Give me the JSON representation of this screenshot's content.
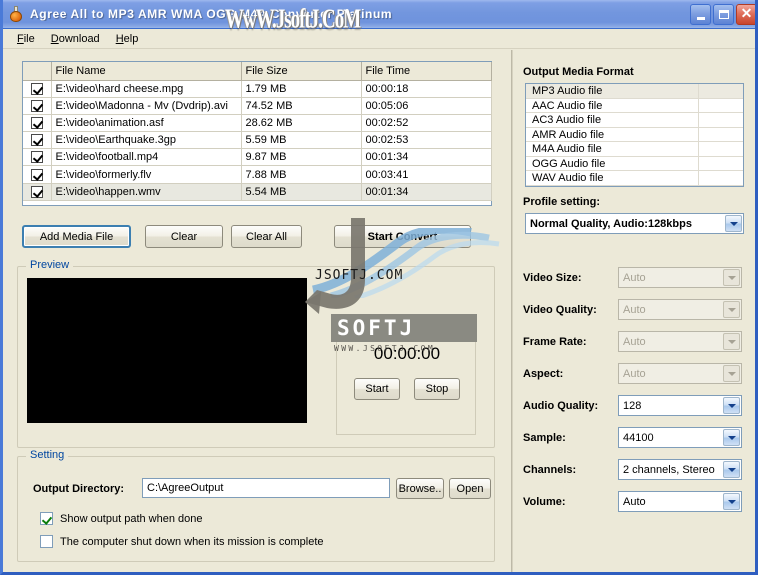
{
  "window": {
    "title": "Agree All to MP3 AMR WMA OGG M4A Converter Platinum",
    "icon": "flask-icon",
    "buttons": {
      "minimize": "minimize-icon",
      "maximize": "maximize-icon",
      "close": "close-icon"
    }
  },
  "menu": {
    "items": [
      {
        "label": "File",
        "accel": "F"
      },
      {
        "label": "Download",
        "accel": "D"
      },
      {
        "label": "Help",
        "accel": "H"
      }
    ]
  },
  "filelist": {
    "columns": [
      "",
      "File Name",
      "File Size",
      "File Time"
    ],
    "rows": [
      {
        "checked": true,
        "name": "E:\\video\\hard cheese.mpg",
        "size": "1.79 MB",
        "time": "00:00:18"
      },
      {
        "checked": true,
        "name": "E:\\video\\Madonna - Mv (Dvdrip).avi",
        "size": "74.52 MB",
        "time": "00:05:06"
      },
      {
        "checked": true,
        "name": "E:\\video\\animation.asf",
        "size": "28.62 MB",
        "time": "00:02:52"
      },
      {
        "checked": true,
        "name": "E:\\video\\Earthquake.3gp",
        "size": "5.59 MB",
        "time": "00:02:53"
      },
      {
        "checked": true,
        "name": "E:\\video\\football.mp4",
        "size": "9.87 MB",
        "time": "00:01:34"
      },
      {
        "checked": true,
        "name": "E:\\video\\formerly.flv",
        "size": "7.88 MB",
        "time": "00:03:41"
      },
      {
        "checked": true,
        "name": "E:\\video\\happen.wmv",
        "size": "5.54 MB",
        "time": "00:01:34"
      }
    ]
  },
  "actions": {
    "add_media": "Add Media File",
    "clear": "Clear",
    "clear_all": "Clear All",
    "start_convert": "Start Convert"
  },
  "preview": {
    "legend": "Preview",
    "timer": "00:00:00",
    "start": "Start",
    "stop": "Stop"
  },
  "setting": {
    "legend": "Setting",
    "output_dir_label": "Output Directory:",
    "output_dir_value": "C:\\AgreeOutput",
    "browse": "Browse..",
    "open": "Open",
    "show_output_path": {
      "label": "Show output path when done",
      "checked": true
    },
    "shutdown": {
      "label": "The computer shut down when its mission is complete",
      "checked": false
    }
  },
  "output_format": {
    "label": "Output Media Format",
    "items": [
      "MP3 Audio file",
      "AAC Audio file",
      "AC3 Audio file",
      "AMR Audio file",
      "M4A Audio file",
      "OGG Audio file",
      "WAV Audio file"
    ],
    "selected": "MP3 Audio file"
  },
  "profile": {
    "label": "Profile setting:",
    "value": "Normal Quality, Audio:128kbps"
  },
  "encoder_settings": [
    {
      "label": "Video Size:",
      "value": "Auto",
      "disabled": true
    },
    {
      "label": "Video Quality:",
      "value": "Auto",
      "disabled": true
    },
    {
      "label": "Frame Rate:",
      "value": "Auto",
      "disabled": true
    },
    {
      "label": "Aspect:",
      "value": "Auto",
      "disabled": true
    },
    {
      "label": "Audio Quality:",
      "value": "128",
      "disabled": false
    },
    {
      "label": "Sample:",
      "value": "44100",
      "disabled": false
    },
    {
      "label": "Channels:",
      "value": "2 channels, Stereo",
      "disabled": false
    },
    {
      "label": "Volume:",
      "value": "Auto",
      "disabled": false
    }
  ],
  "watermark": {
    "title_text": "WwW.JsoftJ.CoM",
    "logo_domain": "JSOFTJ.COM",
    "logo_word": "SOFTJ",
    "logo_sub": "WWW.JSOFTJ.COM"
  },
  "colors": {
    "window_face": "#ece9d8",
    "titlebar": "#7296de",
    "group_legend": "#0046a0",
    "field_border": "#7f9db9",
    "preview_black": "#000000"
  }
}
